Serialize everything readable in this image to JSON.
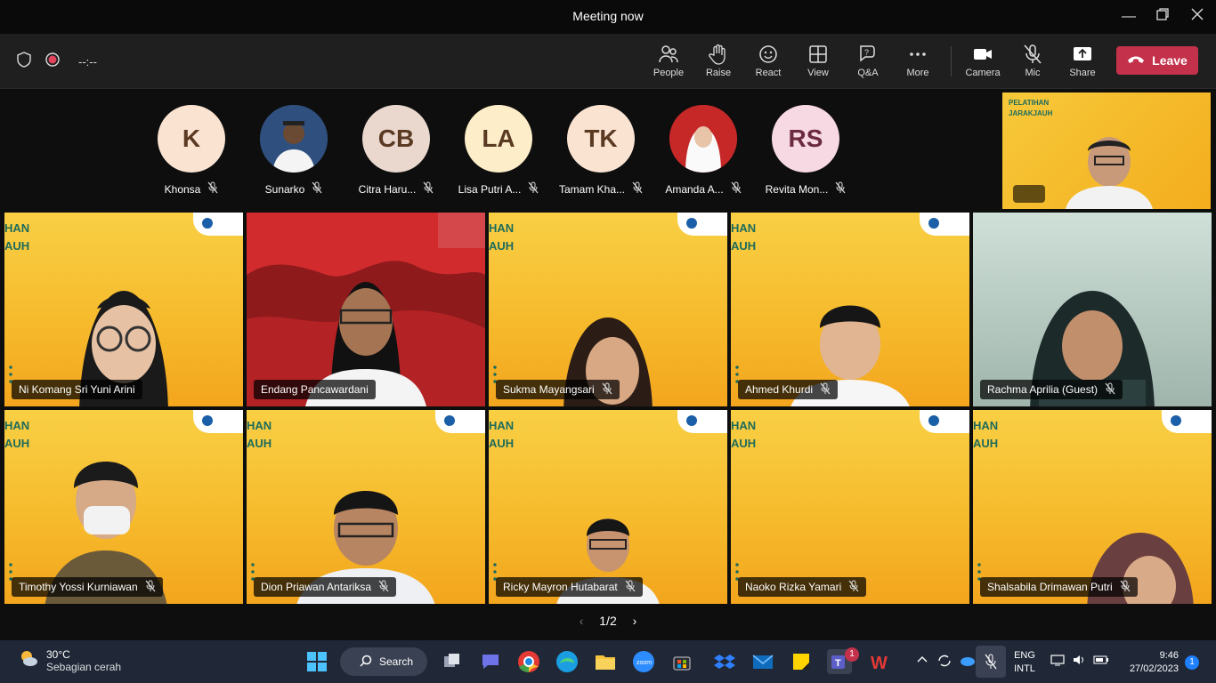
{
  "window": {
    "title": "Meeting now"
  },
  "toolbar": {
    "timer": "--:--",
    "people": "People",
    "raise": "Raise",
    "react": "React",
    "view": "View",
    "qa": "Q&A",
    "more": "More",
    "camera": "Camera",
    "mic": "Mic",
    "share": "Share",
    "leave": "Leave"
  },
  "strip": [
    {
      "initials": "K",
      "name": "Khonsa",
      "color": "#fbe3d2"
    },
    {
      "initials": "",
      "name": "Sunarko",
      "color": "#3a5a8a"
    },
    {
      "initials": "CB",
      "name": "Citra Haru...",
      "color": "#ead8cf"
    },
    {
      "initials": "LA",
      "name": "Lisa Putri A...",
      "color": "#fdeec9"
    },
    {
      "initials": "TK",
      "name": "Tamam Kha...",
      "color": "#fbe3d2"
    },
    {
      "initials": "",
      "name": "Amanda A...",
      "color": "#c62828"
    },
    {
      "initials": "RS",
      "name": "Revita Mon...",
      "color": "#f7d9e3"
    }
  ],
  "selfview": {
    "line1": "PELATIHAN",
    "line2": "JARAKJAUH"
  },
  "tiles": [
    {
      "brand1": "HAN",
      "brand2": "AUH",
      "name": "Ni Komang Sri Yuni Arini",
      "muted": false
    },
    {
      "brand1": "",
      "brand2": "",
      "name": "Endang Pancawardani",
      "muted": false,
      "active": true
    },
    {
      "brand1": "HAN",
      "brand2": "AUH",
      "name": "Sukma Mayangsari",
      "muted": true
    },
    {
      "brand1": "HAN",
      "brand2": "AUH",
      "name": "Ahmed Khurdi",
      "muted": true
    },
    {
      "brand1": "",
      "brand2": "",
      "name": "Rachma Aprilia (Guest)",
      "muted": true
    },
    {
      "brand1": "HAN",
      "brand2": "AUH",
      "name": "Timothy Yossi Kurniawan",
      "muted": true
    },
    {
      "brand1": "HAN",
      "brand2": "AUH",
      "name": "Dion Priawan Antariksa",
      "muted": true
    },
    {
      "brand1": "HAN",
      "brand2": "AUH",
      "name": "Ricky Mayron Hutabarat",
      "muted": true
    },
    {
      "brand1": "HAN",
      "brand2": "AUH",
      "name": "Naoko Rizka Yamari",
      "muted": true
    },
    {
      "brand1": "HAN",
      "brand2": "AUH",
      "name": "Shalsabila Drimawan Putri",
      "muted": true
    }
  ],
  "pager": "1/2",
  "taskbar": {
    "temp": "30°C",
    "weather": "Sebagian cerah",
    "search": "Search",
    "teams_badge": "1",
    "lang1": "ENG",
    "lang2": "INTL",
    "time": "9:46",
    "date": "27/02/2023",
    "notif": "1"
  }
}
